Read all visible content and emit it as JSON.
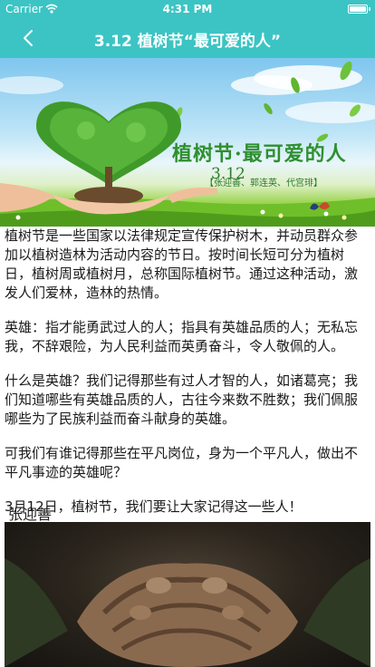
{
  "status_bar": {
    "carrier": "Carrier",
    "time": "4:31 PM"
  },
  "nav": {
    "title": "3.12 植树节“最可爱的人”",
    "back_icon": "chevron-left-icon"
  },
  "hero": {
    "number": "3.12",
    "slogan": "植树节·最可爱的人",
    "credits": "【张迎善、郭连英、代宫琲】"
  },
  "article": {
    "paragraphs": [
      "植树节是一些国家以法律规定宣传保护树木，并动员群众参加以植树造林为活动内容的节日。按时间长短可分为植树日，植树周或植树月，总称国际植树节。通过这种活动，激发人们爱林，造林的热情。",
      "英雄：指才能勇武过人的人；指具有英雄品质的人；无私忘我，不辞艰险，为人民利益而英勇奋斗，令人敬佩的人。",
      "什么是英雄？我们记得那些有过人才智的人，如诸葛亮；我们知道哪些有英雄品质的人，古往今来数不胜数；我们佩服哪些为了民族利益而奋斗献身的英雄。",
      "可我们有谁记得那些在平凡岗位，身为一个平凡人，做出不平凡事迹的英雄呢？",
      "3月12日，植树节，我们要让大家记得这一些人！"
    ],
    "person_name": "张迎善"
  },
  "colors": {
    "accent": "#3cc4c4",
    "text": "#1a1a1a"
  }
}
